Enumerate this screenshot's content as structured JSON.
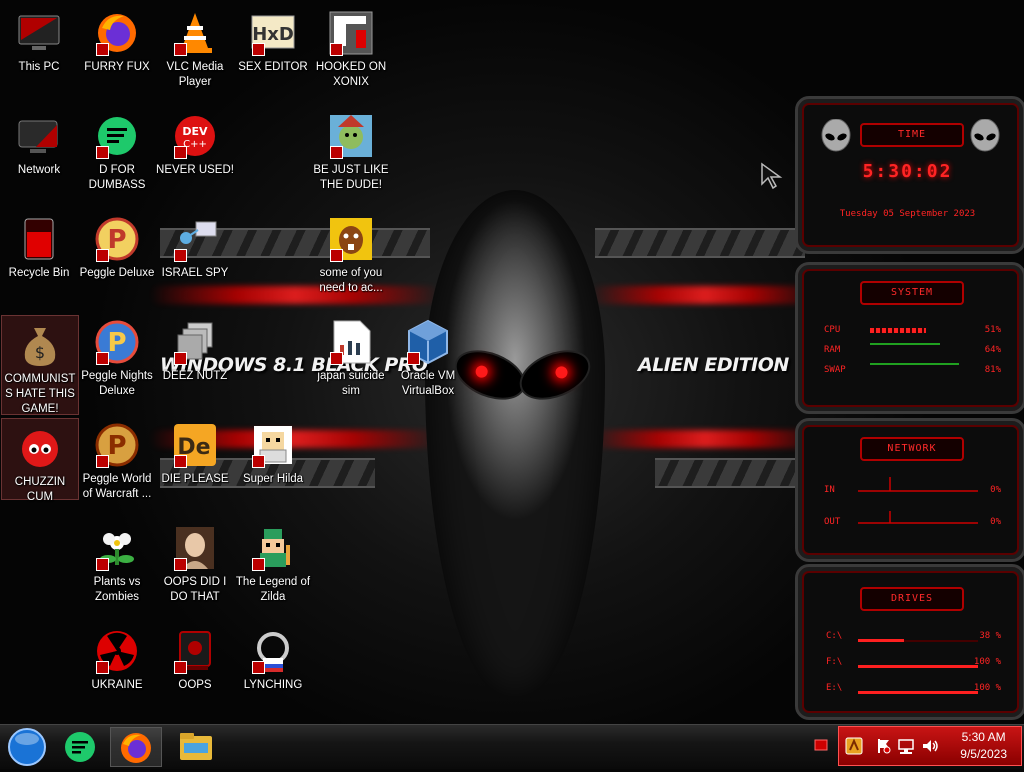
{
  "desktop": {
    "icons": [
      {
        "label": "This PC"
      },
      {
        "label": "Network"
      },
      {
        "label": "Recycle Bin"
      },
      {
        "label": "COMMUNISTS HATE THIS GAME!"
      },
      {
        "label": "CHUZZIN CUM"
      },
      {
        "label": "FURRY FUX"
      },
      {
        "label": "D FOR DUMBASS"
      },
      {
        "label": "Peggle Deluxe"
      },
      {
        "label": "Peggle Nights Deluxe"
      },
      {
        "label": "Peggle World of Warcraft ..."
      },
      {
        "label": "Plants vs Zombies"
      },
      {
        "label": "UKRAINE"
      },
      {
        "label": "VLC Media Player"
      },
      {
        "label": "NEVER USED!"
      },
      {
        "label": "ISRAEL SPY"
      },
      {
        "label": "DEEZ NUTZ"
      },
      {
        "label": "DIE PLEASE"
      },
      {
        "label": "OOPS DID I DO THAT"
      },
      {
        "label": "OOPS"
      },
      {
        "label": "SEX EDITOR"
      },
      {
        "label": "Super Hilda"
      },
      {
        "label": "The Legend of Zilda"
      },
      {
        "label": "LYNCHING"
      },
      {
        "label": "HOOKED ON XONIX"
      },
      {
        "label": "BE JUST LIKE THE DUDE!"
      },
      {
        "label": "some of you need to ac..."
      },
      {
        "label": "japan suicide sim"
      },
      {
        "label": "Oracle VM VirtualBox"
      }
    ]
  },
  "wallpaper": {
    "left_text": "WINDOWS 8.1 BLACK PRO",
    "right_text": "ALIEN EDITION 20"
  },
  "gadgets": {
    "time": {
      "title": "TIME",
      "time": "5:30:02",
      "date": "Tuesday 05 September 2023"
    },
    "system": {
      "title": "SYSTEM",
      "rows": [
        {
          "label": "CPU",
          "value": "51%",
          "fill": 0.51
        },
        {
          "label": "RAM",
          "value": "64%",
          "fill": 0.64
        },
        {
          "label": "SWAP",
          "value": "81%",
          "fill": 0.81
        }
      ]
    },
    "network": {
      "title": "NETWORK",
      "rows": [
        {
          "label": "IN",
          "value": "0%"
        },
        {
          "label": "OUT",
          "value": "0%"
        }
      ]
    },
    "drives": {
      "title": "DRIVES",
      "rows": [
        {
          "label": "C:\\",
          "value": "38 %",
          "fill": 0.38
        },
        {
          "label": "F:\\",
          "value": "100 %",
          "fill": 1.0
        },
        {
          "label": "E:\\",
          "value": "100 %",
          "fill": 1.0
        }
      ]
    }
  },
  "taskbar": {
    "clock_time": "5:30 AM",
    "clock_date": "9/5/2023"
  },
  "colors": {
    "accent_red": "#ff2424",
    "tray_red": "#c81414"
  }
}
